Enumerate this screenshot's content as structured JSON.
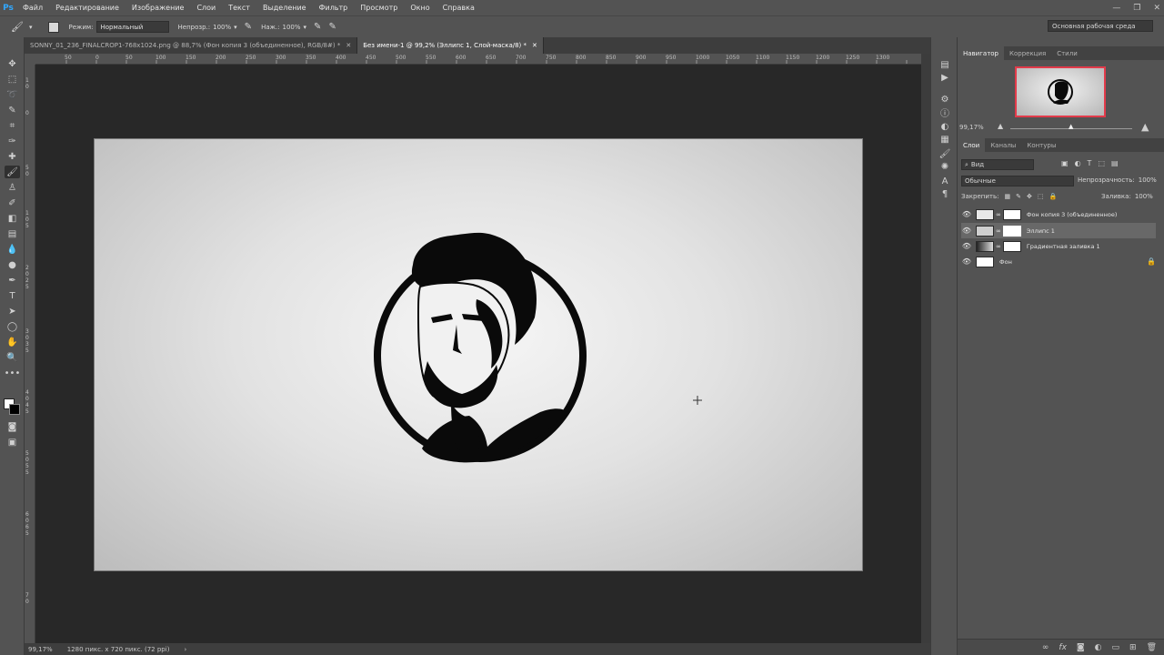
{
  "app": {
    "logo": "Ps"
  },
  "menu": [
    "Файл",
    "Редактирование",
    "Изображение",
    "Слои",
    "Текст",
    "Выделение",
    "Фильтр",
    "Просмотр",
    "Окно",
    "Справка"
  ],
  "options": {
    "mode_label": "Режим:",
    "mode_value": "Нормальный",
    "opacity_label": "Непрозр.:",
    "opacity_value": "100%",
    "flow_label": "Наж.:",
    "flow_value": "100%",
    "workspace": "Основная рабочая среда"
  },
  "tabs": [
    {
      "label": "SONNY_01_236_FINALCROP1-768x1024.png @ 88,7% (Фон копия 3 (объединенное), RGB/8#) *"
    },
    {
      "label": "Без имени-1 @ 99,2% (Эллипс 1, Слой-маска/8) *"
    }
  ],
  "ruler_h": [
    "50",
    "0",
    "50",
    "100",
    "150",
    "200",
    "250",
    "300",
    "350",
    "400",
    "450",
    "500",
    "550",
    "600",
    "650",
    "700",
    "750",
    "800",
    "850",
    "900",
    "950",
    "1000",
    "1050",
    "1100",
    "1150",
    "1200",
    "1250",
    "1300"
  ],
  "ruler_v": [
    "1",
    "0",
    "0",
    "5",
    "0",
    "1",
    "0",
    "5",
    "2",
    "0",
    "2",
    "5",
    "3",
    "0",
    "3",
    "5",
    "4",
    "0",
    "4",
    "5",
    "5",
    "0",
    "5",
    "5",
    "6",
    "0",
    "6",
    "5",
    "7",
    "0"
  ],
  "status": {
    "zoom": "99,17%",
    "docinfo": "1280 пикс. x 720 пикс. (72 ppi)"
  },
  "navigator": {
    "tabs": [
      "Навигатор",
      "Коррекция",
      "Стили"
    ],
    "zoom": "99,17%"
  },
  "layers_panel": {
    "tabs": [
      "Слои",
      "Каналы",
      "Контуры"
    ],
    "filter": "Вид",
    "blend_mode": "Обычные",
    "opacity_label": "Непрозрачность:",
    "opacity_value": "100%",
    "lock_label": "Закрепить:",
    "fill_label": "Заливка:",
    "fill_value": "100%",
    "layers": [
      {
        "name": "Фон копия 3 (объединенное)",
        "selected": false
      },
      {
        "name": "Эллипс 1",
        "selected": true
      },
      {
        "name": "Градиентная заливка 1",
        "selected": false
      },
      {
        "name": "Фон",
        "selected": false
      }
    ]
  },
  "colors": {
    "accent": "#31a8ff",
    "nav_frame": "#e23a4a"
  }
}
